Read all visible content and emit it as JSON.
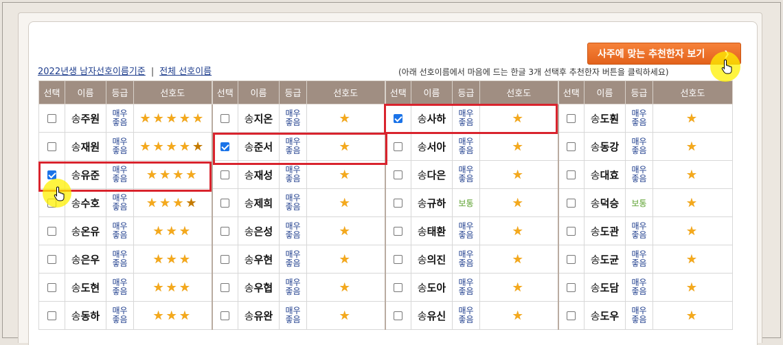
{
  "header": {
    "recommend_button": "사주에 맞는 추천한자 보기",
    "link_male": "2022년생 남자선호이름기준",
    "separator": "|",
    "link_all": "전체 선호이름",
    "instruction": "(아래 선호이름에서 마음에 드는 한글 3개 선택후 추천한자 버튼을 클릭하세요)"
  },
  "table": {
    "headers": [
      "선택",
      "이름",
      "등급",
      "선호도"
    ],
    "surname": "송",
    "columns": [
      [
        {
          "name": "주원",
          "grade": "매우좋음",
          "stars": 5,
          "checked": false
        },
        {
          "name": "재원",
          "grade": "매우좋음",
          "stars": 4.5,
          "checked": false
        },
        {
          "name": "유준",
          "grade": "매우좋음",
          "stars": 4,
          "checked": true
        },
        {
          "name": "수호",
          "grade": "매우좋음",
          "stars": 3.5,
          "checked": false
        },
        {
          "name": "온유",
          "grade": "매우좋음",
          "stars": 3,
          "checked": false
        },
        {
          "name": "은우",
          "grade": "매우좋음",
          "stars": 3,
          "checked": false
        },
        {
          "name": "도현",
          "grade": "매우좋음",
          "stars": 3,
          "checked": false
        },
        {
          "name": "동하",
          "grade": "매우좋음",
          "stars": 3,
          "checked": false
        }
      ],
      [
        {
          "name": "지온",
          "grade": "매우좋음",
          "stars": 1,
          "checked": false
        },
        {
          "name": "준서",
          "grade": "매우좋음",
          "stars": 1,
          "checked": true
        },
        {
          "name": "재성",
          "grade": "매우좋음",
          "stars": 1,
          "checked": false
        },
        {
          "name": "제희",
          "grade": "매우좋음",
          "stars": 1,
          "checked": false
        },
        {
          "name": "은성",
          "grade": "매우좋음",
          "stars": 1,
          "checked": false
        },
        {
          "name": "우현",
          "grade": "매우좋음",
          "stars": 1,
          "checked": false
        },
        {
          "name": "우협",
          "grade": "매우좋음",
          "stars": 1,
          "checked": false
        },
        {
          "name": "유완",
          "grade": "매우좋음",
          "stars": 1,
          "checked": false
        }
      ],
      [
        {
          "name": "사하",
          "grade": "매우좋음",
          "stars": 1,
          "checked": true
        },
        {
          "name": "서아",
          "grade": "매우좋음",
          "stars": 1,
          "checked": false
        },
        {
          "name": "다은",
          "grade": "매우좋음",
          "stars": 1,
          "checked": false
        },
        {
          "name": "규하",
          "grade": "보통",
          "stars": 1,
          "checked": false
        },
        {
          "name": "태환",
          "grade": "매우좋음",
          "stars": 1,
          "checked": false
        },
        {
          "name": "의진",
          "grade": "매우좋음",
          "stars": 1,
          "checked": false
        },
        {
          "name": "도아",
          "grade": "매우좋음",
          "stars": 1,
          "checked": false
        },
        {
          "name": "유신",
          "grade": "매우좋음",
          "stars": 1,
          "checked": false
        }
      ],
      [
        {
          "name": "도훤",
          "grade": "매우좋음",
          "stars": 1,
          "checked": false
        },
        {
          "name": "동강",
          "grade": "매우좋음",
          "stars": 1,
          "checked": false
        },
        {
          "name": "대효",
          "grade": "매우좋음",
          "stars": 1,
          "checked": false
        },
        {
          "name": "덕승",
          "grade": "보통",
          "stars": 1,
          "checked": false
        },
        {
          "name": "도관",
          "grade": "매우좋음",
          "stars": 1,
          "checked": false
        },
        {
          "name": "도균",
          "grade": "매우좋음",
          "stars": 1,
          "checked": false
        },
        {
          "name": "도담",
          "grade": "매우좋음",
          "stars": 1,
          "checked": false
        },
        {
          "name": "도우",
          "grade": "매우좋음",
          "stars": 1,
          "checked": false
        }
      ]
    ]
  },
  "colors": {
    "header_bg": "#a08e82",
    "button_orange": "#ef7428",
    "highlight_red": "#d9232d",
    "link_blue": "#1d3c8c",
    "grade_green": "#5aa02c",
    "star_gold": "#f4a91d"
  },
  "icons": {
    "star": "star-icon",
    "checkbox": "checkbox-icon",
    "cursor": "hand-cursor-icon",
    "arrow": "chevron-right-icon"
  }
}
